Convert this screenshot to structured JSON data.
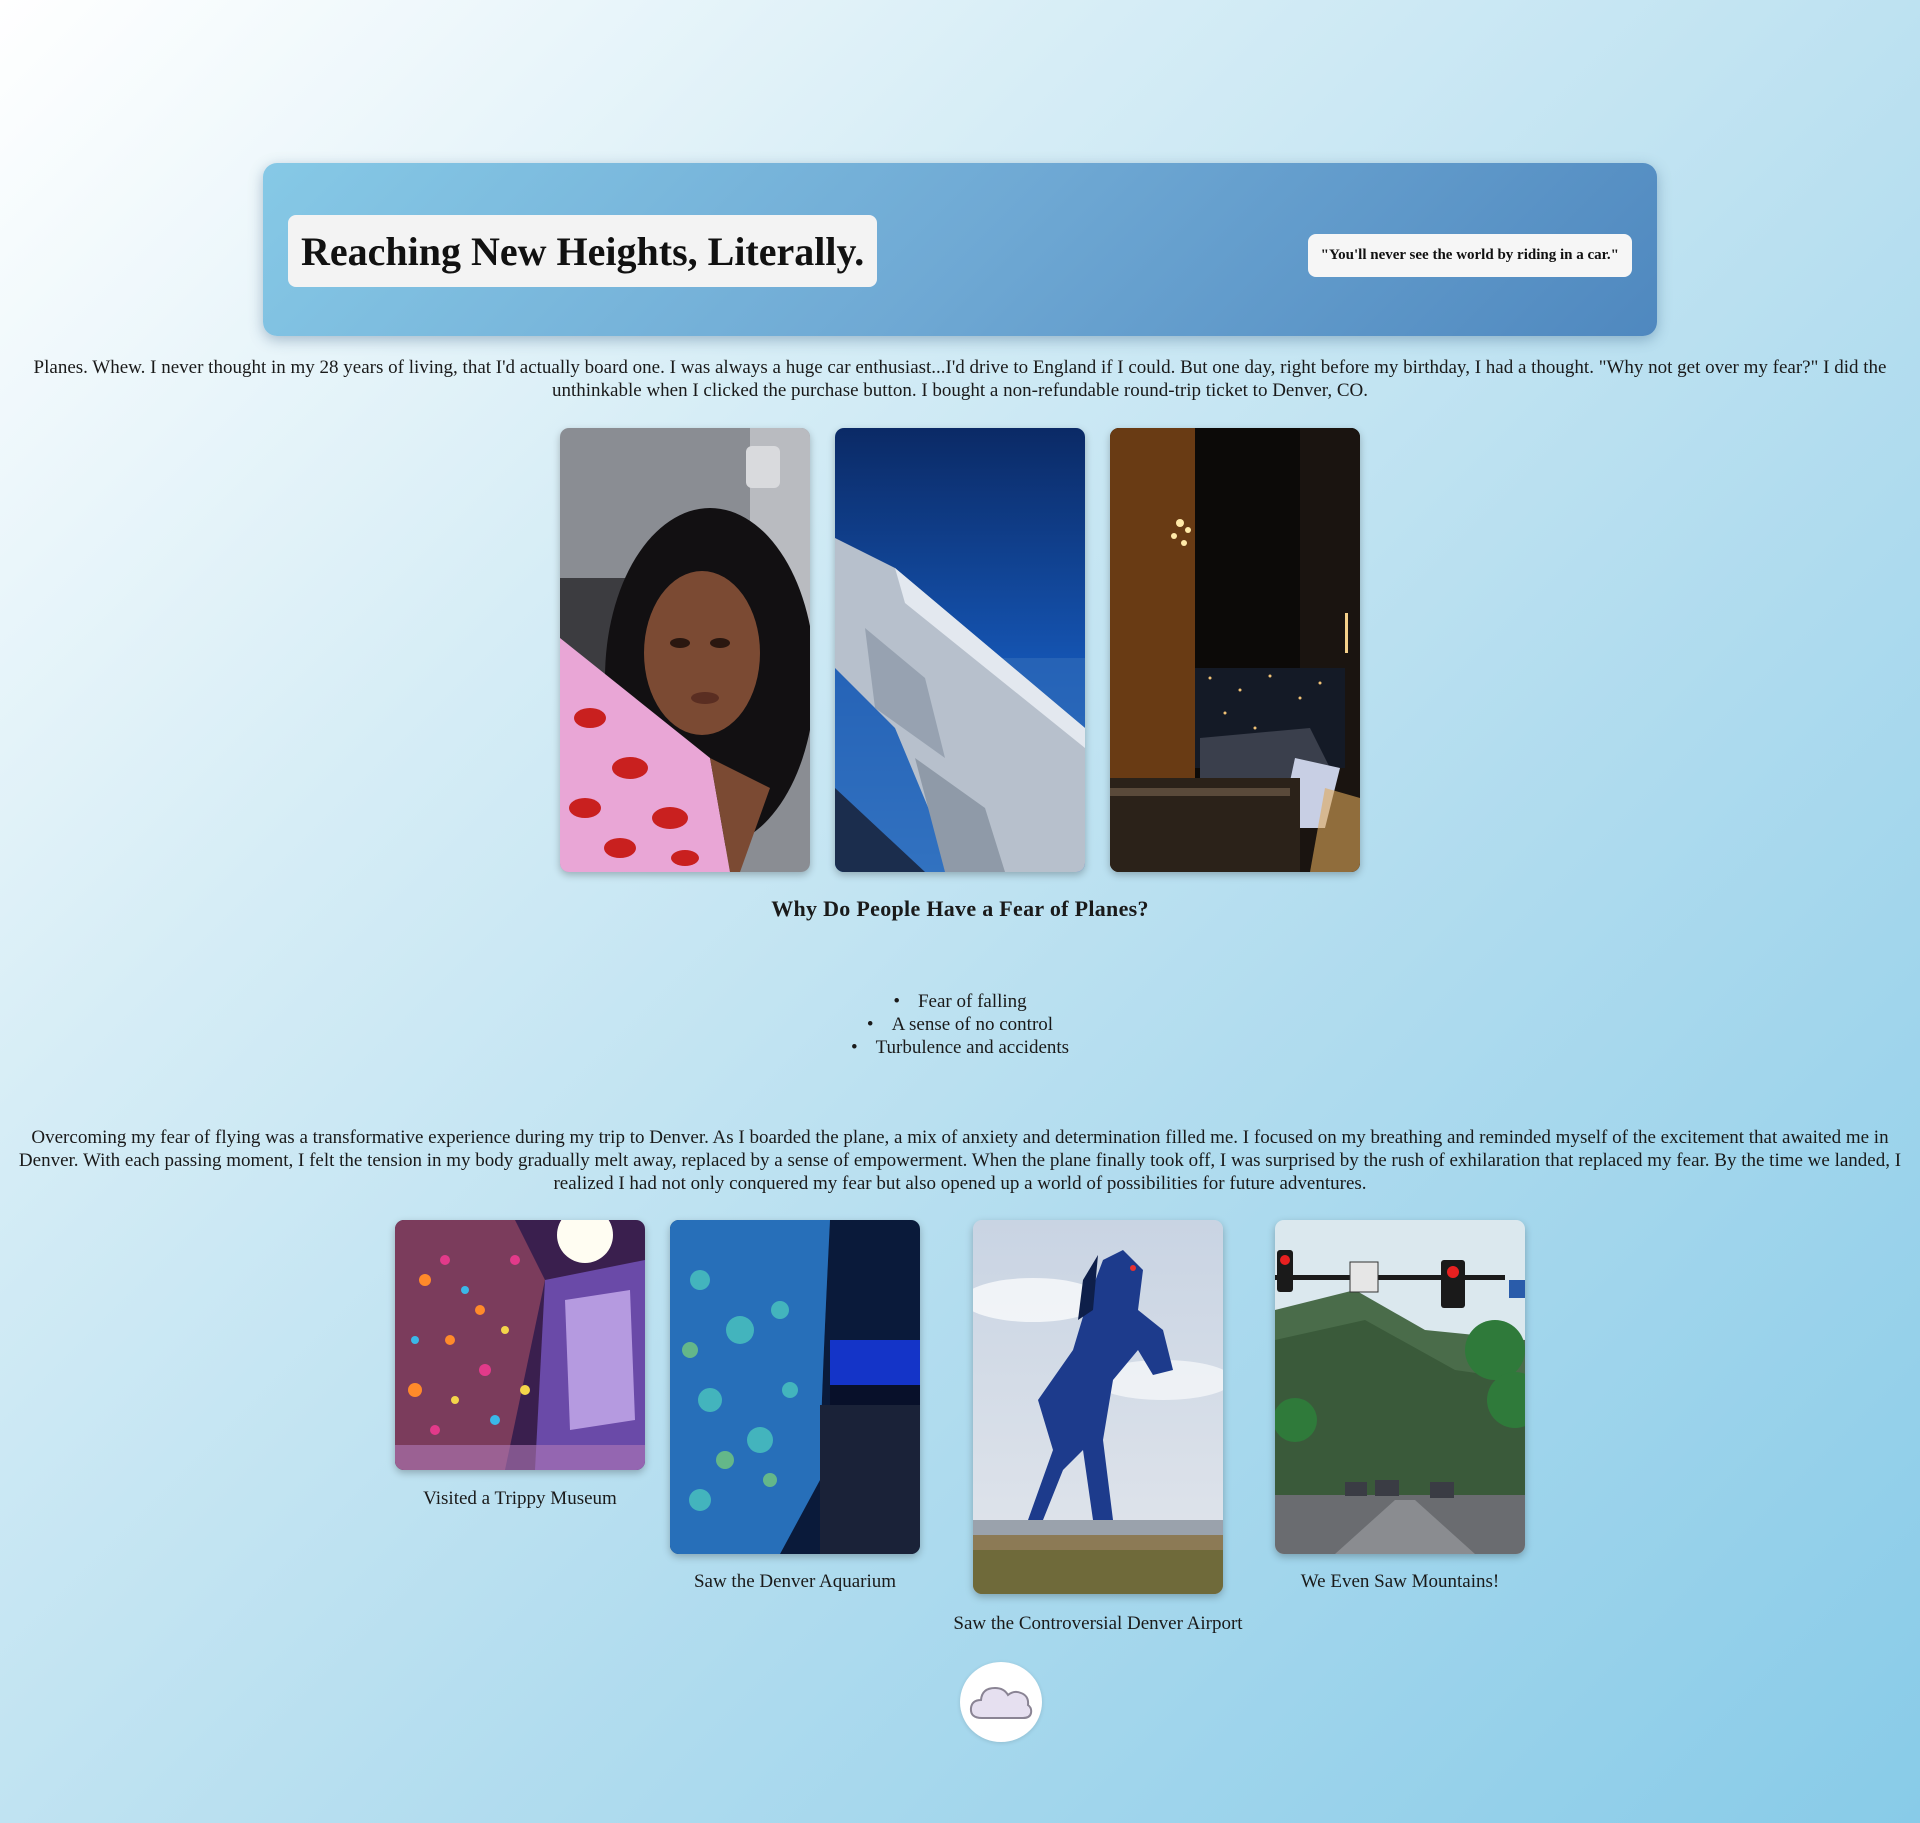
{
  "header": {
    "title": "Reaching New Heights, Literally.",
    "quote": "\"You'll never see the world by riding in a car.\""
  },
  "intro": {
    "text": "Planes. Whew. I never thought in my 28 years of living, that I'd actually board one. I was always a huge car enthusiast...I'd drive to England if I could. But one day, right before my birthday, I had a thought. \"Why not get over my fear?\" I did the unthinkable when I clicked the purchase button. I bought a non-refundable round-trip ticket to Denver, CO."
  },
  "fears": {
    "heading": "Why Do People Have a Fear of Planes?",
    "items": [
      "Fear of falling",
      "A sense of no control",
      "Turbulence and accidents"
    ]
  },
  "story": {
    "text": "Overcoming my fear of flying was a transformative experience during my trip to Denver. As I boarded the plane, a mix of anxiety and determination filled me. I focused on my breathing and reminded myself of the excitement that awaited me in Denver. With each passing moment, I felt the tension in my body gradually melt away, replaced by a sense of empowerment. When the plane finally took off, I was surprised by the rush of exhilaration that replaced my fear. By the time we landed, I realized I had not only conquered my fear but also opened up a world of possibilities for future adventures."
  },
  "gallery": {
    "captions": {
      "museum": "Visited a Trippy Museum",
      "aquarium": "Saw the Denver Aquarium",
      "airport": "Saw the Controversial Denver Airport",
      "mountains": "We Even Saw Mountains!"
    }
  },
  "footer": {
    "icon": "cloud-icon"
  },
  "colors": {
    "banner_start": "#86c9e6",
    "banner_end": "#4f88bf",
    "page_bg_end": "#88cbe8"
  }
}
